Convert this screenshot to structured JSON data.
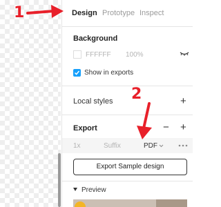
{
  "tabs": [
    {
      "label": "Design",
      "active": true
    },
    {
      "label": "Prototype",
      "active": false
    },
    {
      "label": "Inspect",
      "active": false
    }
  ],
  "background": {
    "title": "Background",
    "color_hex": "FFFFFF",
    "opacity": "100%",
    "show_in_exports_label": "Show in exports",
    "show_in_exports_checked": true
  },
  "local_styles": {
    "title": "Local styles"
  },
  "export": {
    "title": "Export",
    "scale": "1x",
    "suffix_placeholder": "Suffix",
    "format": "PDF",
    "button_label": "Export Sample design"
  },
  "preview": {
    "label": "Preview"
  },
  "annotations": {
    "num1": "1",
    "num2": "2",
    "color": "#e8202a"
  },
  "icons": {
    "eye": "eye-hidden-icon",
    "checkbox": "check-icon",
    "add": "plus-icon",
    "remove": "minus-icon",
    "more": "more-horizontal-icon",
    "caret": "chevron-down-icon",
    "disclosure": "triangle-down-icon"
  }
}
